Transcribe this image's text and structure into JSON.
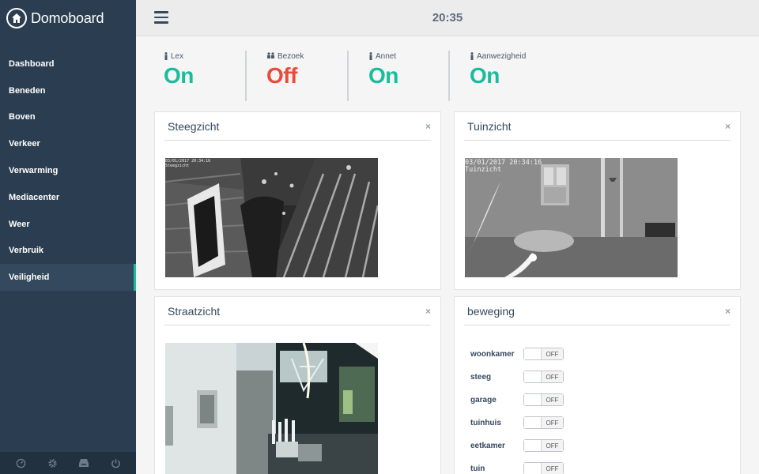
{
  "app": {
    "title": "Domoboard"
  },
  "topbar": {
    "time": "20:35"
  },
  "sidebar": {
    "items": [
      {
        "label": "Dashboard",
        "active": false
      },
      {
        "label": "Beneden",
        "active": false
      },
      {
        "label": "Boven",
        "active": false
      },
      {
        "label": "Verkeer",
        "active": false
      },
      {
        "label": "Verwarming",
        "active": false
      },
      {
        "label": "Mediacenter",
        "active": false
      },
      {
        "label": "Weer",
        "active": false
      },
      {
        "label": "Verbruik",
        "active": false
      },
      {
        "label": "Veiligheid",
        "active": true
      }
    ],
    "footer_icons": [
      "gauge-icon",
      "gear-icon",
      "inbox-icon",
      "power-icon"
    ]
  },
  "status": [
    {
      "label": "Lex",
      "value": "On",
      "icon": "person-icon"
    },
    {
      "label": "Bezoek",
      "value": "Off",
      "icon": "group-icon"
    },
    {
      "label": "Annet",
      "value": "On",
      "icon": "person-icon"
    },
    {
      "label": "Aanwezigheid",
      "value": "On",
      "icon": "person-icon"
    }
  ],
  "panels": {
    "steeg": {
      "title": "Steegzicht",
      "close": "×",
      "stamp": "03/01/2017 20:34:16\nSteegzicht"
    },
    "tuin": {
      "title": "Tuinzicht",
      "close": "×",
      "stamp": "03/01/2017 20:34:16\nTuinzicht"
    },
    "straat": {
      "title": "Straatzicht",
      "close": "×"
    },
    "beweging": {
      "title": "beweging",
      "close": "×",
      "switches": [
        {
          "label": "woonkamer",
          "state": "OFF"
        },
        {
          "label": "steeg",
          "state": "OFF"
        },
        {
          "label": "garage",
          "state": "OFF"
        },
        {
          "label": "tuinhuis",
          "state": "OFF"
        },
        {
          "label": "eetkamer",
          "state": "OFF"
        },
        {
          "label": "tuin",
          "state": "OFF"
        }
      ]
    }
  },
  "colors": {
    "sidebar": "#2b3e51",
    "accent": "#1abc9c",
    "off": "#e74c3c"
  }
}
